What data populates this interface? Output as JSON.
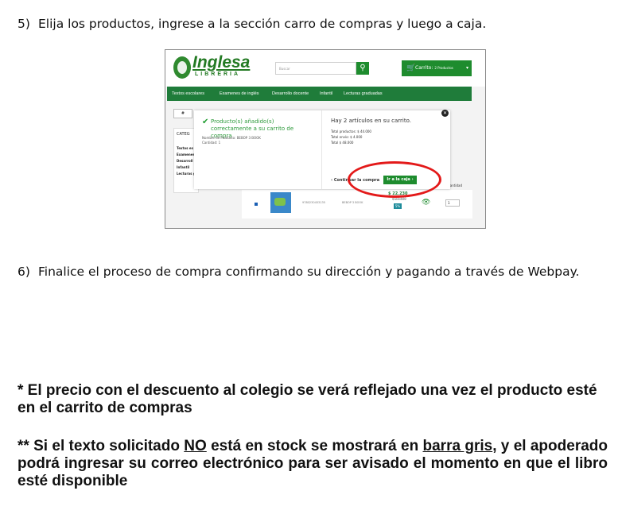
{
  "step5": {
    "number": "5)",
    "text": "Elija los productos, ingrese a la sección carro de compras y luego a caja."
  },
  "step6": {
    "number": "6)",
    "text": "Finalice el proceso de compra confirmando su dirección y pagando a través de Webpay."
  },
  "screenshot": {
    "logo": {
      "name": "Inglesa",
      "subtitle": "LIBRERIA"
    },
    "search_placeholder": "Buscar",
    "cart": {
      "label": "Carrito:",
      "count": "2 Productos"
    },
    "nav": [
      "Textos escolares",
      "Examenes de inglés",
      "Desarrollo docente",
      "Infantil",
      "Lecturas graduadas"
    ],
    "breadcrumb": "#",
    "categories": {
      "title": "CATEG",
      "items": [
        "Textos es",
        "Examenes",
        "Desarroll",
        "Infantil",
        "Lecturas g"
      ]
    },
    "modal": {
      "success": "Producto(s) añadido(s) correctamente a su carrito de compra",
      "product_name": "Nombre de Producto: BEBOP 3 BOOK",
      "quantity": "Cantidad: 1",
      "summary": "Hay 2 artículos en su carrito.",
      "total_products": "Total productos: $ 44.000",
      "shipping": "Total envío: $ 4.000",
      "total": "Total $ 48.000",
      "continue": "Continuar la compra",
      "checkout": "Ir a la caja"
    },
    "product_row": {
      "isbn": "9780230453135",
      "title": "BEBOP 3 BOOK",
      "price": "$ 22.230",
      "old_price": "$ 23.400",
      "discount": "5%",
      "quantity": "1",
      "quantity_header": "Cantidad"
    },
    "colors": {
      "brand_green": "#1e8c2e",
      "nav_green": "#1f7c3a",
      "highlight_red": "#e31919"
    }
  },
  "notes": {
    "note1": "* El precio con el descuento al colegio se verá reflejado una vez el producto esté en el carrito de compras",
    "note2_part1": "** Si el texto solicitado ",
    "note2_no": "NO",
    "note2_part2": " está en stock se mostrará en ",
    "note2_barra": "barra gris",
    "note2_part3": ", y el apoderado podrá ingresar su correo electrónico para ser avisado el momento en que el libro esté disponible"
  }
}
